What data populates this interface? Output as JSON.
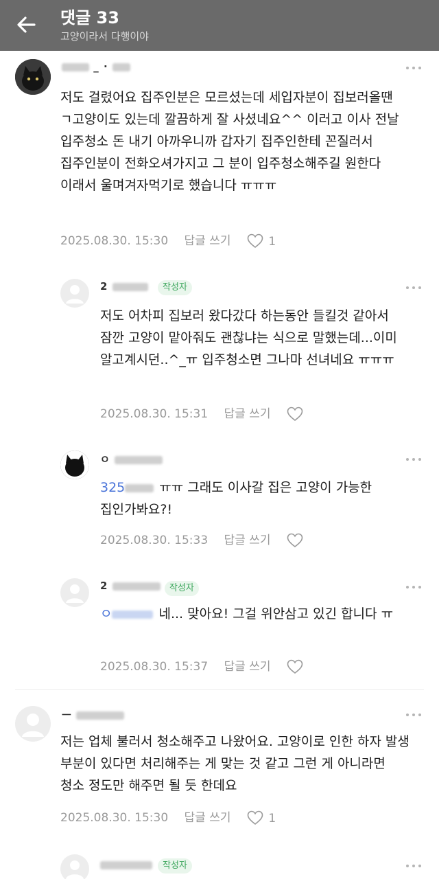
{
  "header": {
    "title": "댓글 33",
    "subtitle": "고양이라서 다행이야"
  },
  "comments": [
    {
      "author_visible": "_ ·",
      "text": "저도 걸렸어요 집주인분은 모르셨는데 세입자분이 집보러올땐 ㄱ고양이도 있는데 깔끔하게 잘 사셨네요^^ 이러고 이사 전날 입주청소 돈 내기 아까우니까 갑자기 집주인한테 꼰질러서 집주인분이 전화오셔가지고 그 분이 입주청소해주길 원한다 이래서 울며겨자먹기로 했습니다 ㅠㅠㅠ",
      "date": "2025.08.30. 15:30",
      "reply_label": "답글 쓰기",
      "like_count": "1",
      "replies": [
        {
          "author_visible": "2",
          "badge": "작성자",
          "text": "저도 어차피 집보러 왔다갔다 하는동안 들킬것 같아서 잠깐 고양이 맡아줘도 괜찮냐는 식으로 말했는데...이미 알고계시던..^_ㅠ 입주청소면 그나마 선녀네요 ㅠㅠㅠ",
          "date": "2025.08.30. 15:31",
          "reply_label": "답글 쓰기"
        },
        {
          "author_visible": "ㅇ",
          "mention": "325",
          "text": "ㅠㅠ 그래도 이사갈 집은 고양이 가능한 집인가봐요?!",
          "date": "2025.08.30. 15:33",
          "reply_label": "답글 쓰기"
        },
        {
          "author_visible": "2",
          "badge": "작성자",
          "mention": "ㅇ",
          "text": "네... 맞아요! 그걸 위안삼고 있긴 합니다 ㅠ",
          "date": "2025.08.30. 15:37",
          "reply_label": "답글 쓰기"
        }
      ]
    },
    {
      "author_visible": "ㅡ",
      "text": "저는 업체 불러서 청소해주고 나왔어요. 고양이로 인한 하자 발생 부분이 있다면 처리해주는 게 맞는 것 같고 그런 게 아니라면 청소 정도만 해주면 될 듯 한데요",
      "date": "2025.08.30. 15:30",
      "reply_label": "답글 쓰기",
      "like_count": "1",
      "replies": [
        {
          "author_visible": "",
          "badge": "작성자"
        }
      ]
    }
  ],
  "colors": {
    "header_bg": "#6a6a6a",
    "badge_text": "#3aa55a",
    "badge_bg": "#e9f6ec",
    "mention": "#4a74d9",
    "meta": "#9a9a9a"
  },
  "icons": {
    "back": "arrow-left-icon",
    "more": "more-dots-icon",
    "like": "heart-icon"
  }
}
